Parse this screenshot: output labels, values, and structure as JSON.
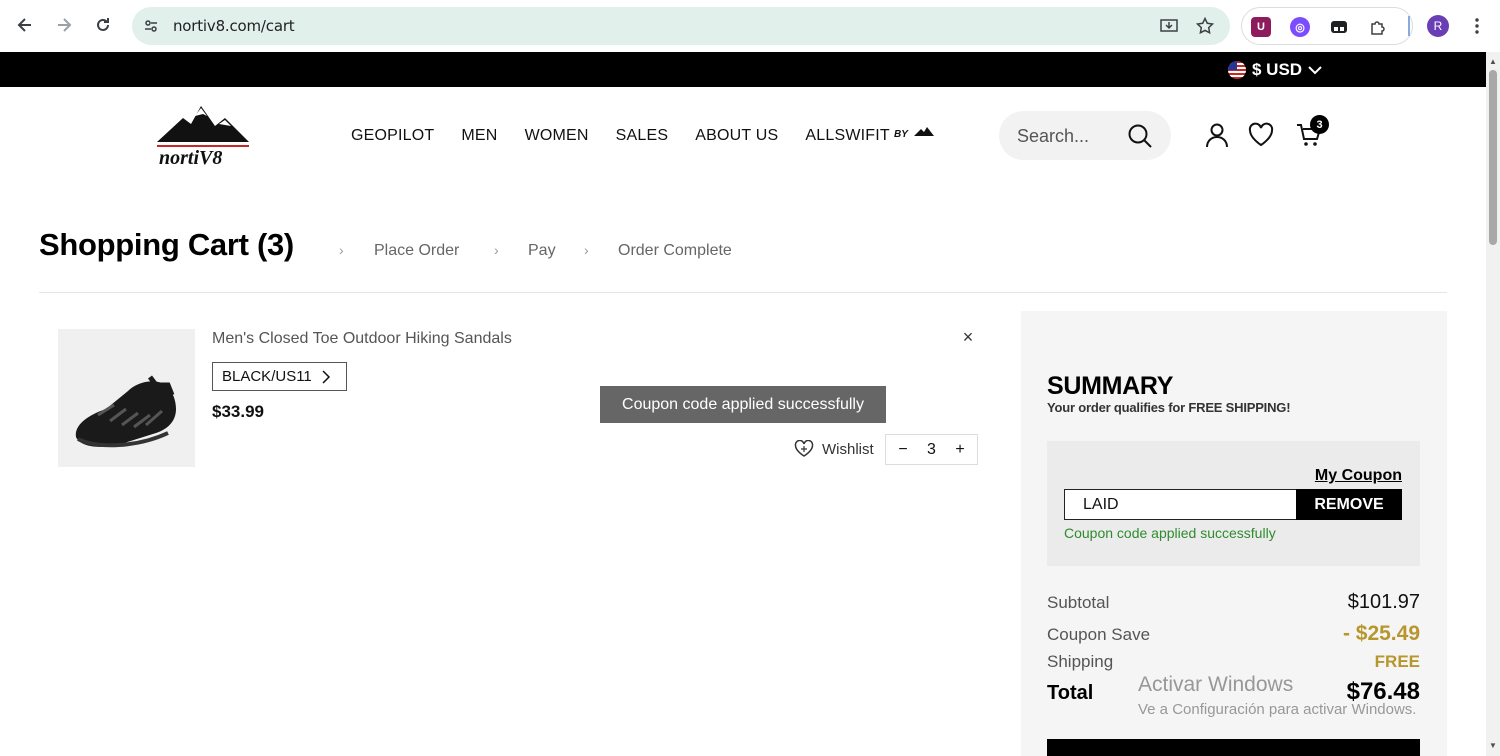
{
  "browser": {
    "url": "nortiv8.com/cart",
    "profile_initial": "R",
    "icons": [
      "back-icon",
      "forward-icon",
      "reload-icon",
      "site-info-icon",
      "install-icon",
      "bookmark-star-icon",
      "extensions-icon",
      "menu-icon"
    ]
  },
  "topbar": {
    "currency": "$ USD"
  },
  "header": {
    "logo_text": "nortiV8",
    "nav": [
      "GEOPILOT",
      "MEN",
      "WOMEN",
      "SALES",
      "ABOUT US",
      "ALLSWIFIT"
    ],
    "nav_by": "BY",
    "search_placeholder": "Search...",
    "cart_count": "3"
  },
  "breadcrumb": {
    "title": "Shopping Cart (3)",
    "steps": [
      "Place Order",
      "Pay",
      "Order Complete"
    ]
  },
  "cart_item": {
    "name": "Men's Closed Toe Outdoor Hiking Sandals",
    "variant": "BLACK/US11",
    "price": "$33.99",
    "wishlist_label": "Wishlist",
    "quantity": "3",
    "minus": "−",
    "plus": "+",
    "remove": "×"
  },
  "toast": "Coupon code applied successfully",
  "summary": {
    "title": "SUMMARY",
    "subtitle": "Your order qualifies for FREE SHIPPING!",
    "my_coupon": "My Coupon",
    "coupon_code": "LAID",
    "coupon_button": "REMOVE",
    "coupon_message": "Coupon code applied successfully",
    "subtotal_label": "Subtotal",
    "subtotal_value": "$101.97",
    "coupon_save_label": "Coupon Save",
    "coupon_save_value": "- $25.49",
    "shipping_label": "Shipping",
    "shipping_value": "FREE",
    "total_label": "Total",
    "total_value": "$76.48"
  },
  "watermark": {
    "line1": "Activar Windows",
    "line2": "Ve a Configuración para activar Windows."
  },
  "colors": {
    "accent_gold": "#b8962e",
    "success_green": "#2e8b2e",
    "url_bar": "#e2f0ec"
  }
}
